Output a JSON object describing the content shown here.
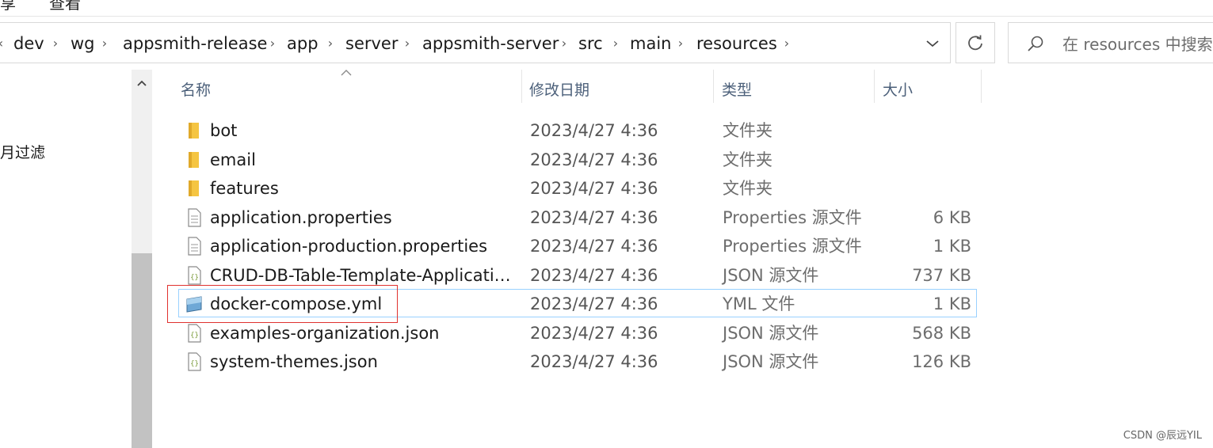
{
  "ribbon": {
    "share_fragment": "享",
    "view_label": "查看"
  },
  "address_bar": {
    "path": [
      "dev",
      "wg",
      "appsmith-release",
      "app",
      "server",
      "appsmith-server",
      "src",
      "main",
      "resources"
    ]
  },
  "search": {
    "placeholder": "在 resources 中搜索"
  },
  "nav_pane": {
    "fragment_label": "月过滤"
  },
  "columns": {
    "name": "名称",
    "date": "修改日期",
    "type": "类型",
    "size": "大小"
  },
  "files": [
    {
      "name": "bot",
      "date": "2023/4/27 4:36",
      "type": "文件夹",
      "size": "",
      "icon": "folder-icon"
    },
    {
      "name": "email",
      "date": "2023/4/27 4:36",
      "type": "文件夹",
      "size": "",
      "icon": "folder-icon"
    },
    {
      "name": "features",
      "date": "2023/4/27 4:36",
      "type": "文件夹",
      "size": "",
      "icon": "folder-icon"
    },
    {
      "name": "application.properties",
      "date": "2023/4/27 4:36",
      "type": "Properties 源文件",
      "size": "6 KB",
      "icon": "document-icon"
    },
    {
      "name": "application-production.properties",
      "date": "2023/4/27 4:36",
      "type": "Properties 源文件",
      "size": "1 KB",
      "icon": "document-icon"
    },
    {
      "name": "CRUD-DB-Table-Template-Applicatio...",
      "date": "2023/4/27 4:36",
      "type": "JSON 源文件",
      "size": "737 KB",
      "icon": "json-file-icon"
    },
    {
      "name": "docker-compose.yml",
      "date": "2023/4/27 4:36",
      "type": "YML 文件",
      "size": "1 KB",
      "icon": "yml-file-icon"
    },
    {
      "name": "examples-organization.json",
      "date": "2023/4/27 4:36",
      "type": "JSON 源文件",
      "size": "568 KB",
      "icon": "json-file-icon"
    },
    {
      "name": "system-themes.json",
      "date": "2023/4/27 4:36",
      "type": "JSON 源文件",
      "size": "126 KB",
      "icon": "json-file-icon"
    }
  ],
  "selected_file": "docker-compose.yml",
  "watermark": "CSDN @辰远YIL",
  "colors": {
    "selection_border": "#99d1ff",
    "highlight_box": "#e0322f",
    "folder": "#f5c542"
  }
}
